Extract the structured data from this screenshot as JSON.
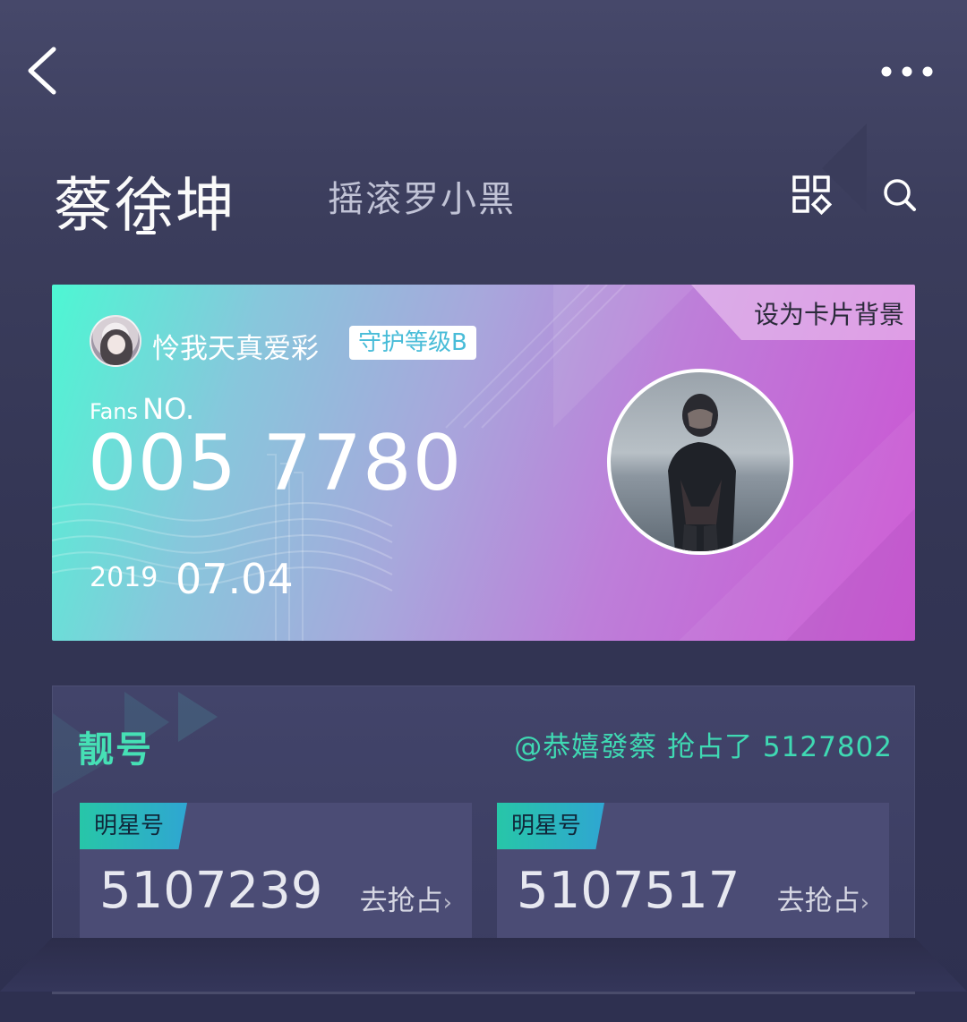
{
  "header": {
    "star_name": "蔡徐坤",
    "secondary_name": "摇滚罗小黑"
  },
  "fan_card": {
    "set_background_label": "设为卡片背景",
    "fan_name": "怜我天真爱彩",
    "guard_level": "守护等级B",
    "fans_label_small": "Fans",
    "fans_label_big": "NO.",
    "fans_number": "005 7780",
    "date_year": "2019",
    "date_day": "07.04",
    "colors": {
      "gradient_start": "#4df7d3",
      "gradient_end": "#cc52d3"
    }
  },
  "pretty_number": {
    "title": "靓号",
    "notice": "@恭嬉發蔡 抢占了 5127802",
    "cards": [
      {
        "tag": "明星号",
        "number": "5107239",
        "action": "去抢占"
      },
      {
        "tag": "明星号",
        "number": "5107517",
        "action": "去抢占"
      }
    ],
    "colors": {
      "accent": "#46e0b5"
    }
  },
  "icons": [
    "back-icon",
    "more-icon",
    "qr-grid-icon",
    "search-icon",
    "chevron-right-icon"
  ]
}
